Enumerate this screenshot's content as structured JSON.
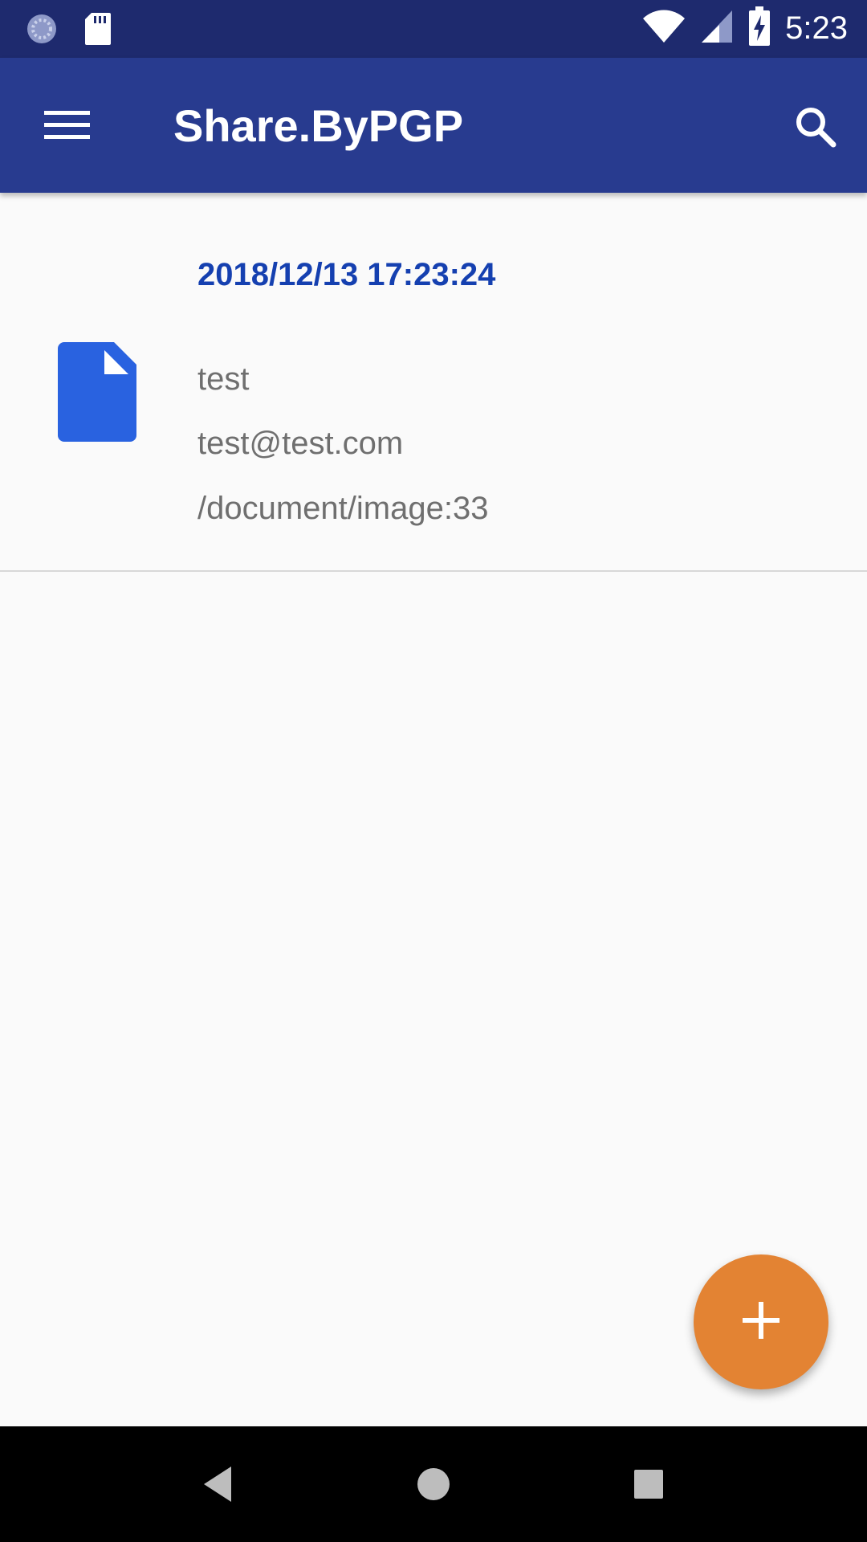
{
  "status_bar": {
    "time": "5:23",
    "icons": [
      "loading-icon",
      "sd-card-icon",
      "wifi-icon",
      "cell-signal-icon",
      "battery-charging-icon"
    ]
  },
  "app_bar": {
    "title": "Share.ByPGP",
    "menu_icon": "hamburger-menu-icon",
    "search_icon": "search-icon",
    "color": "#283b8f",
    "status_color": "#1e2a6e"
  },
  "list": {
    "items": [
      {
        "date": "2018/12/13 17:23:24",
        "name": "test",
        "email": "test@test.com",
        "path": "/document/image:33",
        "icon": "file-icon",
        "icon_color": "#2962e0"
      }
    ]
  },
  "fab": {
    "icon": "plus-icon",
    "color": "#e38333"
  },
  "nav_bar": {
    "buttons": [
      "back-icon",
      "home-icon",
      "recents-icon"
    ]
  }
}
